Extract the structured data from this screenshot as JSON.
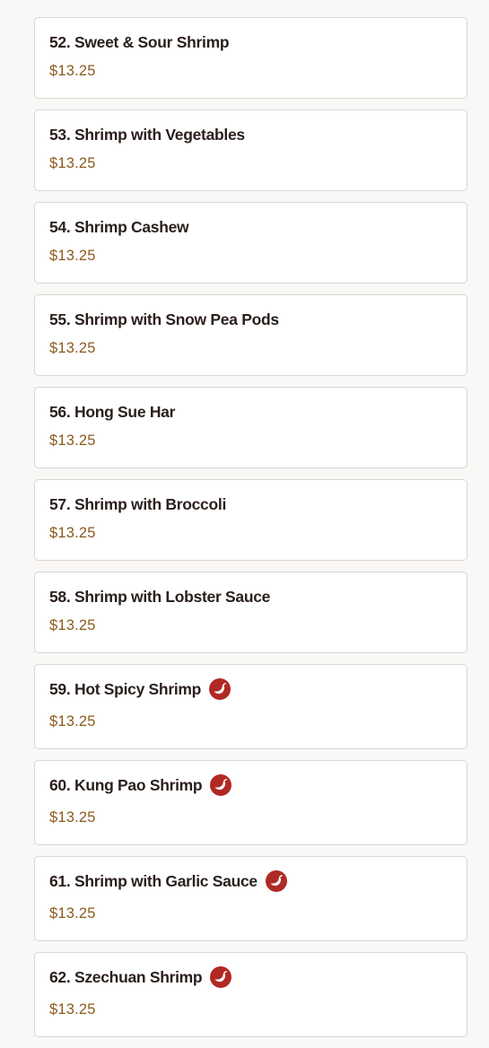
{
  "colors": {
    "page_background": "#f9f8f6",
    "card_background": "#ffffff",
    "card_border": "#d9d6d2",
    "name_text": "#2a1f1c",
    "price_text": "#8a5a1f",
    "spicy_badge": "#b02a25"
  },
  "menu": {
    "items": [
      {
        "name": "52. Sweet & Sour Shrimp",
        "price": "$13.25",
        "spicy": false
      },
      {
        "name": "53. Shrimp with Vegetables",
        "price": "$13.25",
        "spicy": false
      },
      {
        "name": "54. Shrimp Cashew",
        "price": "$13.25",
        "spicy": false
      },
      {
        "name": "55. Shrimp with Snow Pea Pods",
        "price": "$13.25",
        "spicy": false
      },
      {
        "name": "56. Hong Sue Har",
        "price": "$13.25",
        "spicy": false
      },
      {
        "name": "57. Shrimp with Broccoli",
        "price": "$13.25",
        "spicy": false
      },
      {
        "name": "58. Shrimp with Lobster Sauce",
        "price": "$13.25",
        "spicy": false
      },
      {
        "name": "59. Hot Spicy Shrimp",
        "price": "$13.25",
        "spicy": true,
        "icon": "chili-pepper-icon"
      },
      {
        "name": "60. Kung Pao Shrimp",
        "price": "$13.25",
        "spicy": true,
        "icon": "chili-pepper-icon"
      },
      {
        "name": "61. Shrimp with Garlic Sauce",
        "price": "$13.25",
        "spicy": true,
        "icon": "chili-pepper-icon"
      },
      {
        "name": "62. Szechuan Shrimp",
        "price": "$13.25",
        "spicy": true,
        "icon": "chili-pepper-icon"
      }
    ]
  }
}
